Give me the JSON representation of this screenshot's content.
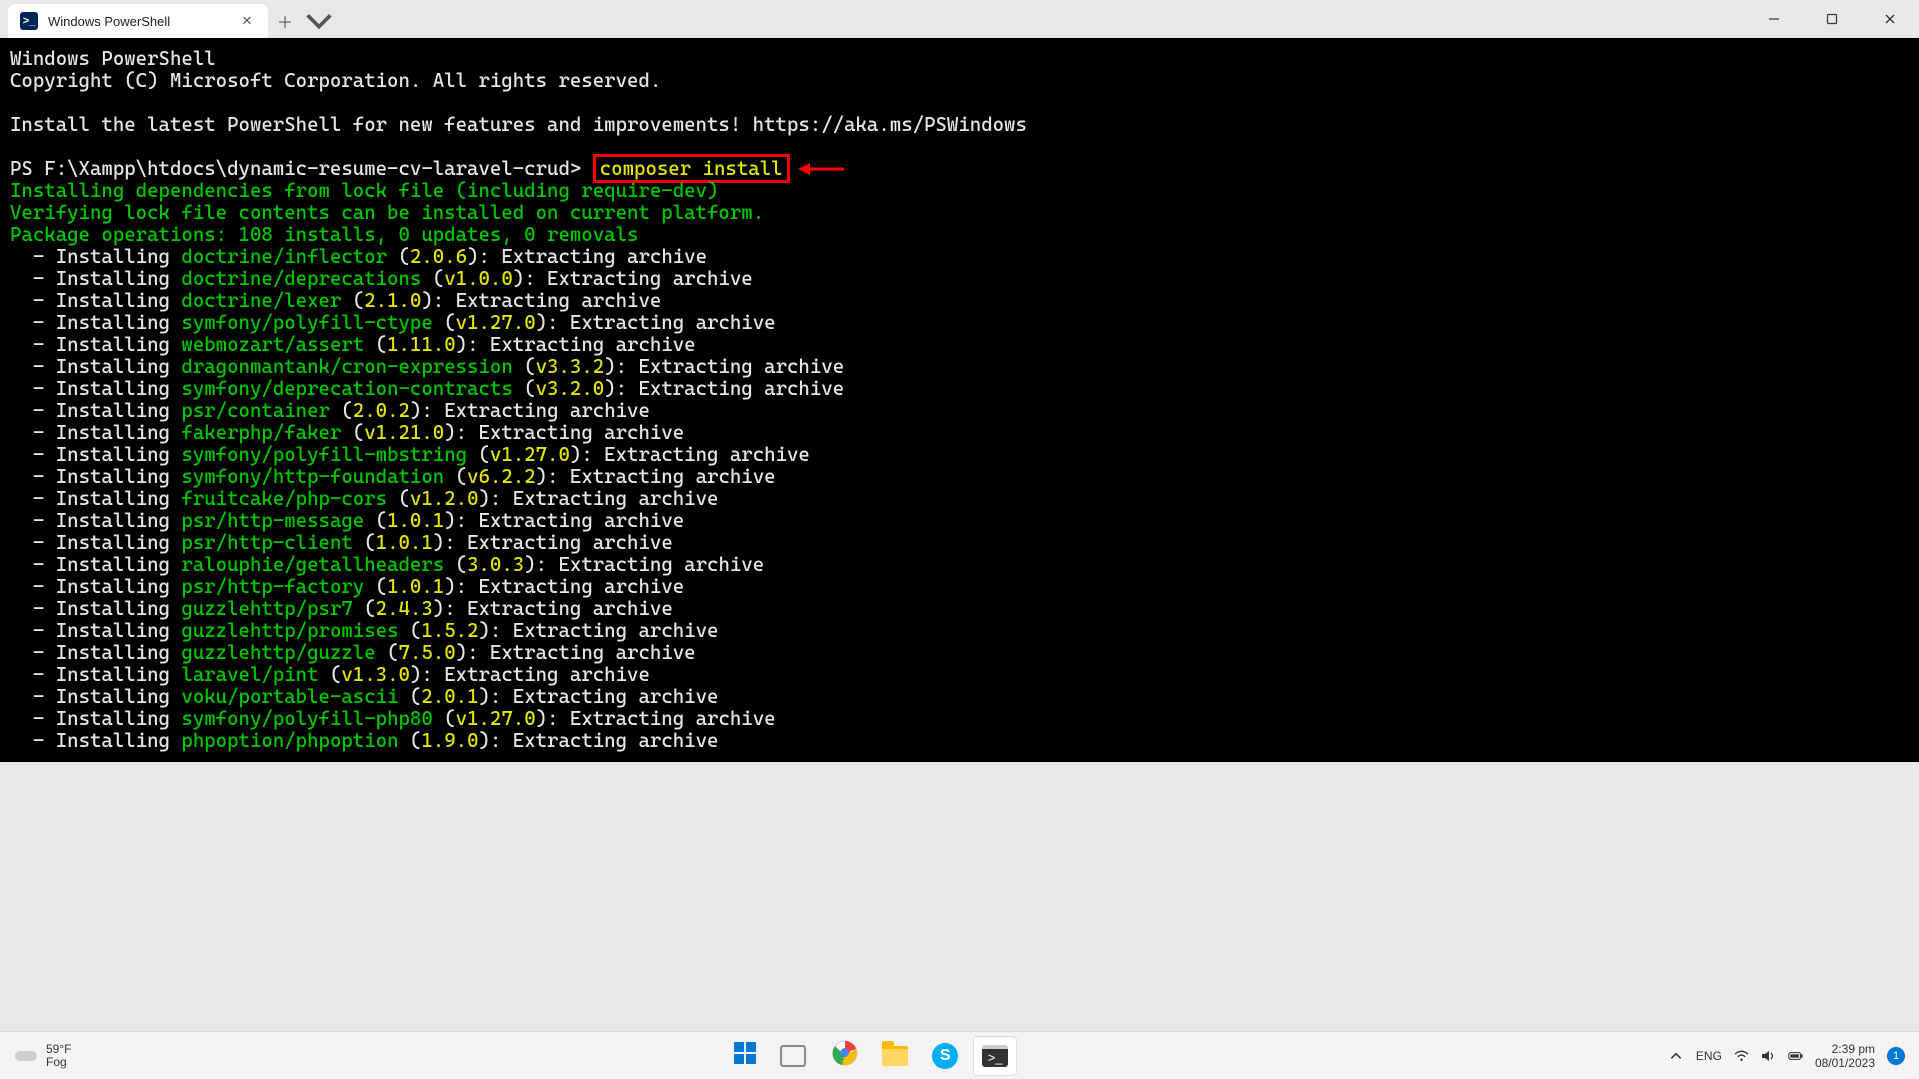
{
  "window": {
    "tab_title": "Windows PowerShell"
  },
  "terminal": {
    "header": [
      "Windows PowerShell",
      "Copyright (C) Microsoft Corporation. All rights reserved."
    ],
    "install_msg": "Install the latest PowerShell for new features and improvements! https://aka.ms/PSWindows",
    "prompt": "PS F:\\Xampp\\htdocs\\dynamic-resume-cv-laravel-crud>",
    "command": "composer install",
    "status_lines": [
      "Installing dependencies from lock file (including require-dev)",
      "Verifying lock file contents can be installed on current platform.",
      "Package operations: 108 installs, 0 updates, 0 removals"
    ],
    "packages": [
      {
        "name": "doctrine/inflector",
        "version": "2.0.6"
      },
      {
        "name": "doctrine/deprecations",
        "version": "v1.0.0"
      },
      {
        "name": "doctrine/lexer",
        "version": "2.1.0"
      },
      {
        "name": "symfony/polyfill-ctype",
        "version": "v1.27.0"
      },
      {
        "name": "webmozart/assert",
        "version": "1.11.0"
      },
      {
        "name": "dragonmantank/cron-expression",
        "version": "v3.3.2"
      },
      {
        "name": "symfony/deprecation-contracts",
        "version": "v3.2.0"
      },
      {
        "name": "psr/container",
        "version": "2.0.2"
      },
      {
        "name": "fakerphp/faker",
        "version": "v1.21.0"
      },
      {
        "name": "symfony/polyfill-mbstring",
        "version": "v1.27.0"
      },
      {
        "name": "symfony/http-foundation",
        "version": "v6.2.2"
      },
      {
        "name": "fruitcake/php-cors",
        "version": "v1.2.0"
      },
      {
        "name": "psr/http-message",
        "version": "1.0.1"
      },
      {
        "name": "psr/http-client",
        "version": "1.0.1"
      },
      {
        "name": "ralouphie/getallheaders",
        "version": "3.0.3"
      },
      {
        "name": "psr/http-factory",
        "version": "1.0.1"
      },
      {
        "name": "guzzlehttp/psr7",
        "version": "2.4.3"
      },
      {
        "name": "guzzlehttp/promises",
        "version": "1.5.2"
      },
      {
        "name": "guzzlehttp/guzzle",
        "version": "7.5.0"
      },
      {
        "name": "laravel/pint",
        "version": "v1.3.0"
      },
      {
        "name": "voku/portable-ascii",
        "version": "2.0.1"
      },
      {
        "name": "symfony/polyfill-php80",
        "version": "v1.27.0"
      },
      {
        "name": "phpoption/phpoption",
        "version": "1.9.0"
      }
    ],
    "install_prefix": "Installing",
    "extract_suffix": "Extracting archive"
  },
  "taskbar": {
    "weather_temp": "59°F",
    "weather_desc": "Fog",
    "lang": "ENG",
    "time": "2:39 pm",
    "date": "08/01/2023",
    "notif_count": "1",
    "skype_initial": "S"
  }
}
